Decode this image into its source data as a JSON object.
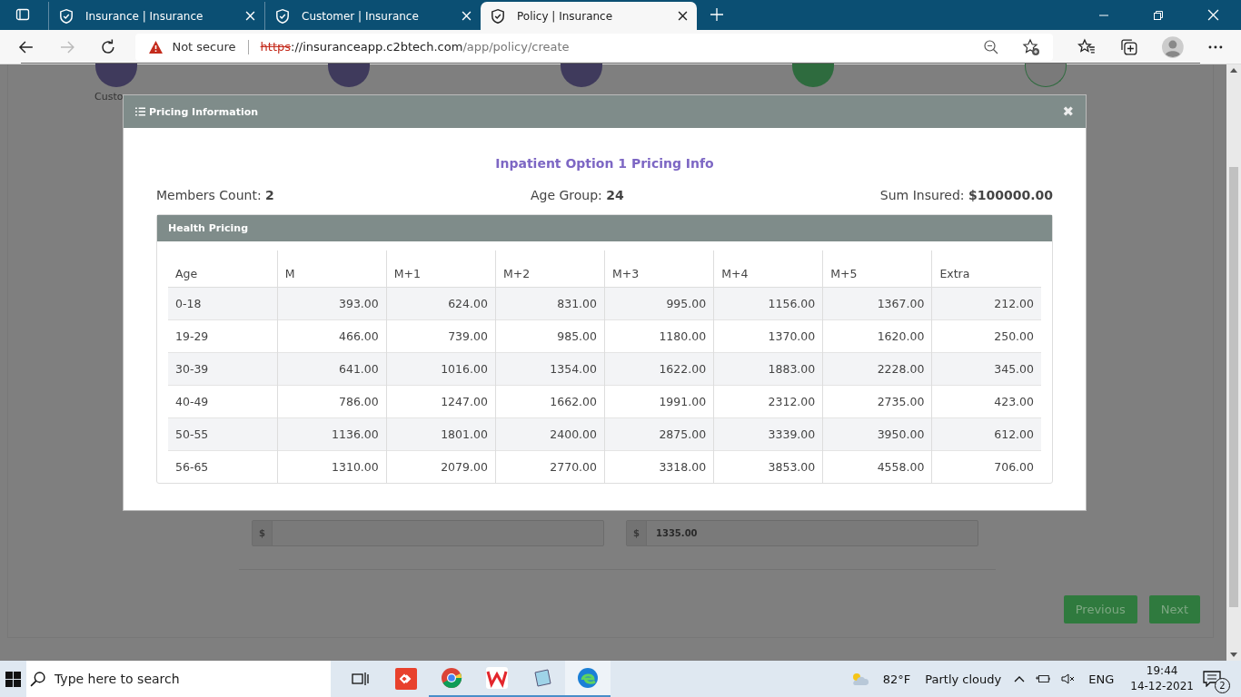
{
  "browser": {
    "tabs": [
      {
        "title": "Insurance | Insurance",
        "selected": false
      },
      {
        "title": "Customer | Insurance",
        "selected": false
      },
      {
        "title": "Policy | Insurance",
        "selected": true
      }
    ],
    "security": "Not secure",
    "address": {
      "scheme": "https",
      "host": "://insuranceapp.c2btech.com",
      "path": "/app/policy/create"
    }
  },
  "steps": [
    {
      "kind": "filled",
      "color": "#3f3a5c",
      "label": "Custo"
    },
    {
      "kind": "filled",
      "color": "#3f3a5c"
    },
    {
      "kind": "filled",
      "color": "#3f3a5c"
    },
    {
      "kind": "filled",
      "color": "#2e6b3e"
    },
    {
      "kind": "outline",
      "color": "#2e6b3e"
    }
  ],
  "page": {
    "amount_fields": [
      {
        "prefix": "$"
      },
      {
        "prefix": "$",
        "value": "1335.00"
      }
    ],
    "buttons": [
      "Previous",
      "Next"
    ]
  },
  "modal": {
    "title": "Pricing Information",
    "close": "✖",
    "heading": "Inpatient Option 1 Pricing Info",
    "summary": [
      {
        "label": "Members Count:",
        "value": "2"
      },
      {
        "label": "Age Group:",
        "value": "24"
      },
      {
        "label": "Sum Insured:",
        "value": "$100000.00"
      }
    ],
    "panel_title": "Health Pricing",
    "table": {
      "columns": [
        "Age",
        "M",
        "M+1",
        "M+2",
        "M+3",
        "M+4",
        "M+5",
        "Extra"
      ],
      "rows": [
        [
          "0-18",
          "393.00",
          "624.00",
          "831.00",
          "995.00",
          "1156.00",
          "1367.00",
          "212.00"
        ],
        [
          "19-29",
          "466.00",
          "739.00",
          "985.00",
          "1180.00",
          "1370.00",
          "1620.00",
          "250.00"
        ],
        [
          "30-39",
          "641.00",
          "1016.00",
          "1354.00",
          "1622.00",
          "1883.00",
          "2228.00",
          "345.00"
        ],
        [
          "40-49",
          "786.00",
          "1247.00",
          "1662.00",
          "1991.00",
          "2312.00",
          "2735.00",
          "423.00"
        ],
        [
          "50-55",
          "1136.00",
          "1801.00",
          "2400.00",
          "2875.00",
          "3339.00",
          "3950.00",
          "612.00"
        ],
        [
          "56-65",
          "1310.00",
          "2079.00",
          "2770.00",
          "3318.00",
          "3853.00",
          "4558.00",
          "706.00"
        ]
      ]
    }
  },
  "taskbar": {
    "search_placeholder": "Type here to search",
    "temperature": "82°F",
    "weather": "Partly cloudy",
    "language": "ENG",
    "time": "19:44",
    "date": "14-12-2021",
    "notifications": "2"
  }
}
